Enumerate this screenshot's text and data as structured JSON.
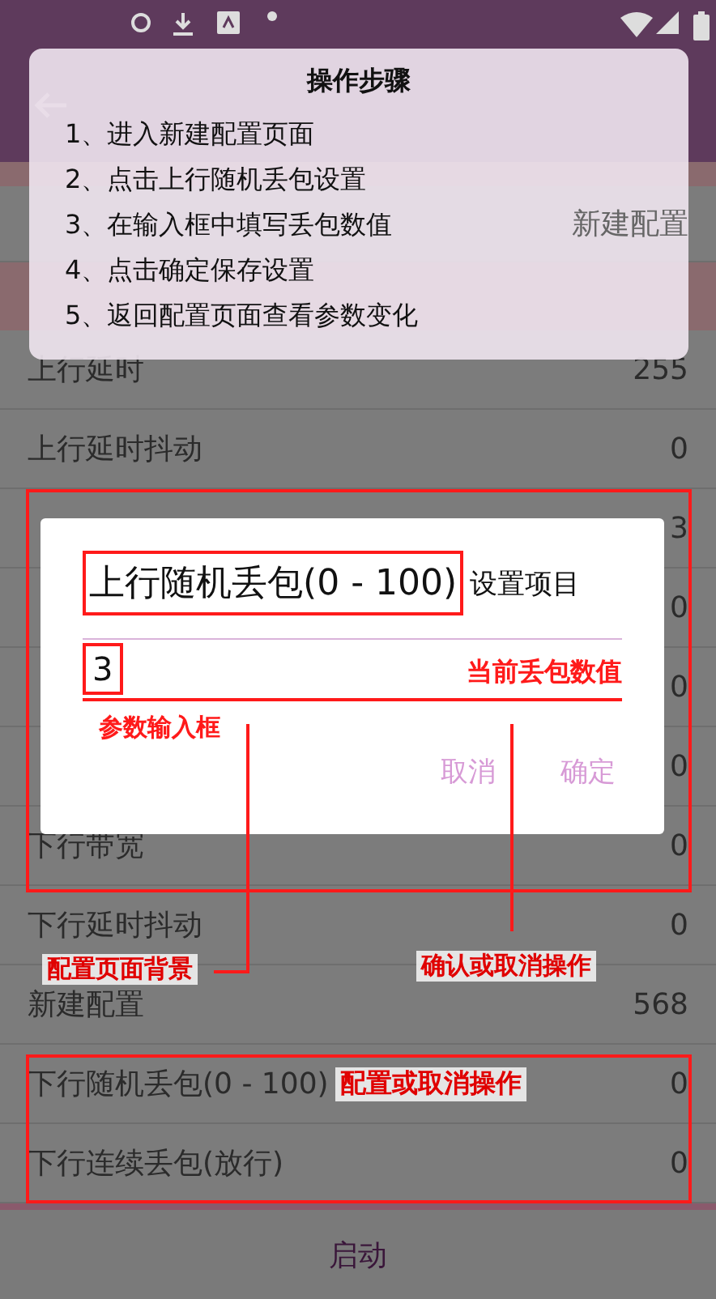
{
  "steps": {
    "title": "操作步骤",
    "items": [
      "1、进入新建配置页面",
      "2、点击上行随机丢包设置",
      "3、在输入框中填写丢包数值",
      "4、点击确定保存设置",
      "5、返回配置页面查看参数变化"
    ]
  },
  "rows": [
    {
      "value": "新建配置"
    },
    {
      "label": "上行延时",
      "value": "255"
    },
    {
      "label": "上行延时抖动",
      "value": "0"
    },
    {
      "value": "3"
    },
    {
      "value": "0"
    },
    {
      "value": "0"
    },
    {
      "value": "0"
    },
    {
      "label": "下行带宽",
      "value": "0"
    },
    {
      "label": "下行延时抖动",
      "value": "0"
    },
    {
      "label": "新建配置",
      "value": "568"
    },
    {
      "label": "下行随机丢包(0 - 100)",
      "value": "0",
      "note": "配置或取消操作"
    },
    {
      "label": "下行连续丢包(放行)",
      "value": "0"
    }
  ],
  "start_button": "启动",
  "dialog": {
    "title": "上行随机丢包(0 - 100)",
    "value": "3",
    "buttons": [
      "取消",
      "确定"
    ]
  },
  "annotations": {
    "title_note": "设置项目",
    "value_note": "当前丢包数值",
    "input_note": "参数输入框",
    "background_note": "配置页面背景",
    "buttons_note": "确认或取消操作"
  }
}
